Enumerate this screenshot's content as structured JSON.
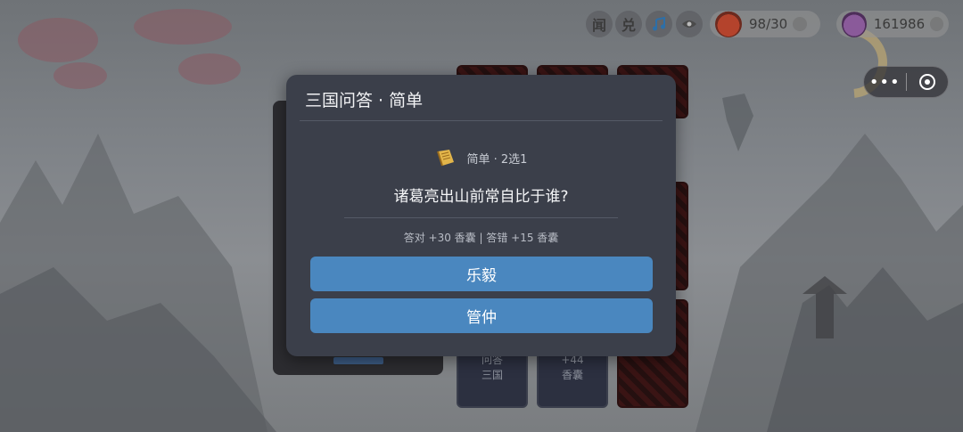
{
  "hud": {
    "icon_labels": [
      "闻",
      "兑"
    ],
    "bag_counter": "98/30",
    "coin_counter": "161986"
  },
  "cards": {
    "card_a_label": "问答\n三国",
    "card_b_label": "+44\n香囊"
  },
  "dialog": {
    "title": "三国问答 · 简单",
    "meta": "简单 · 2选1",
    "question": "诸葛亮出山前常自比于谁?",
    "reward": "答对 +30 香囊 | 答错 +15 香囊",
    "options": [
      "乐毅",
      "管仲"
    ]
  },
  "colors": {
    "dialog_bg": "#3b3f4a",
    "option_bg": "#4a87bf"
  }
}
